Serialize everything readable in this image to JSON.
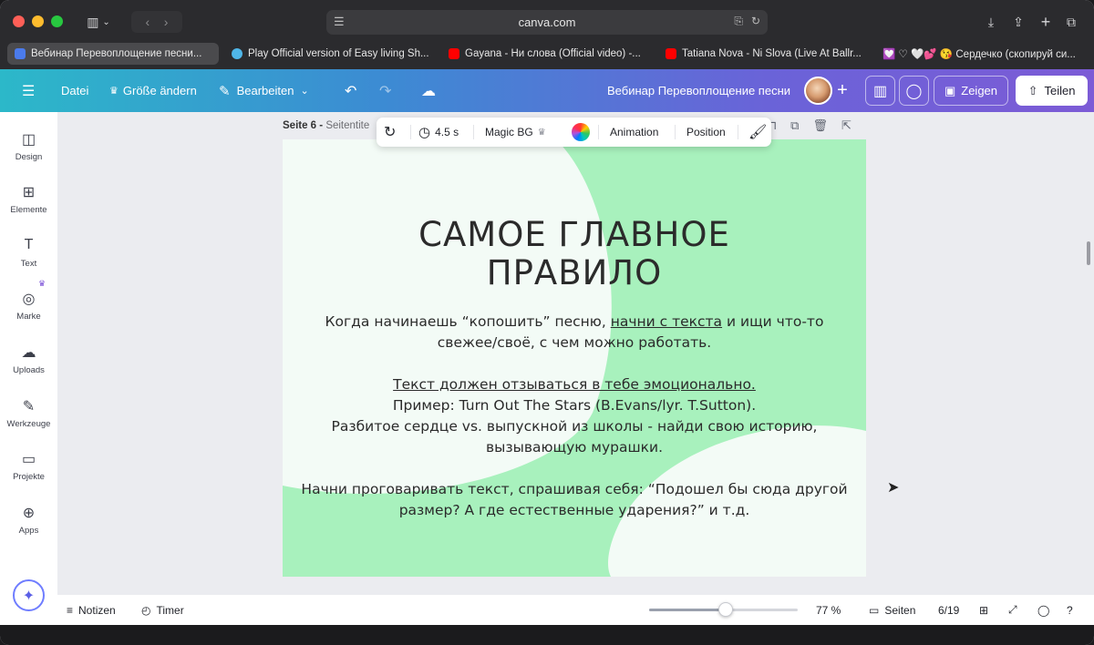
{
  "browser": {
    "url": "canva.com",
    "tabs": [
      {
        "label": "Вебинар Перевоплощение песни...",
        "active": true,
        "favicon_color": "#4b7bec"
      },
      {
        "label": "Play Official version of Easy living Sh...",
        "active": false,
        "favicon_color": "#4fb6e8"
      },
      {
        "label": "Gayana - Ни слова (Official video) -...",
        "active": false,
        "favicon_color": "#ff0000"
      },
      {
        "label": "Tatiana Nova - Ni Slova (Live At Ballr...",
        "active": false,
        "favicon_color": "#ff0000"
      },
      {
        "label": "💟 ♡ 🤍💕 😘 Сердечко (скопируй си...",
        "active": false,
        "favicon_color": "#8e6bd8"
      }
    ]
  },
  "toolbar": {
    "menu_icon": "hamburger-icon",
    "datei": "Datei",
    "resize": "Größe ändern",
    "edit": "Bearbeiten",
    "doc_title": "Вебинар Перевоплощение песни",
    "present": "Zeigen",
    "share": "Teilen"
  },
  "rail": [
    {
      "label": "Design",
      "icon": "design-icon",
      "glyph": "◫"
    },
    {
      "label": "Elemente",
      "icon": "elements-icon",
      "glyph": "⊞"
    },
    {
      "label": "Text",
      "icon": "text-icon",
      "glyph": "T"
    },
    {
      "label": "Marke",
      "icon": "brand-icon",
      "glyph": "◎"
    },
    {
      "label": "Uploads",
      "icon": "upload-icon",
      "glyph": "☁"
    },
    {
      "label": "Werkzeuge",
      "icon": "tools-icon",
      "glyph": "✎"
    },
    {
      "label": "Projekte",
      "icon": "folder-icon",
      "glyph": "▭"
    },
    {
      "label": "Apps",
      "icon": "apps-icon",
      "glyph": "⊕"
    }
  ],
  "page": {
    "label": "Seite 6 - ",
    "sublabel": "Seitentite"
  },
  "context_toolbar": {
    "duration": "4.5 s",
    "magic_bg": "Magic BG",
    "animation": "Animation",
    "position": "Position"
  },
  "slide": {
    "title_line1": "САМОЕ ГЛАВНОЕ",
    "title_line2": "ПРАВИЛО",
    "p1_a": "Когда начинаешь “копошить” песню, ",
    "p1_link": "начни с текста",
    "p1_b": " и ищи что-то свежее/своё, с чем можно работать.",
    "p2_line1": "Текст должен отзываться в тебе эмоционально.",
    "p2_line2": "Пример: Turn Out The Stars (B.Evans/lyr. T.Sutton).",
    "p2_line3": "Разбитое сердце vs. выпускной из школы - найди свою историю, вызывающую мурашки.",
    "p3": "Начни проговаривать текст, спрашивая себя: “Подошел бы сюда другой размер? А где естественные ударения?” и т.д."
  },
  "bottom": {
    "notes": "Notizen",
    "timer": "Timer",
    "zoom": "77 %",
    "zoom_fraction": 0.48,
    "pages": "Seiten",
    "page_count": "6/19"
  },
  "colors": {
    "slide_green": "#a8f1bd",
    "slide_white": "#f3fbf6",
    "accent": "#7c5bd6"
  }
}
